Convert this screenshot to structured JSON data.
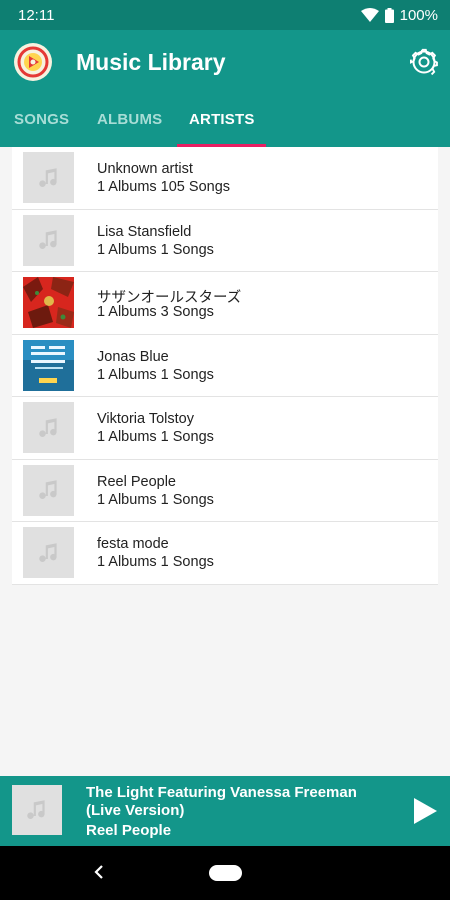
{
  "status": {
    "time": "12:11",
    "battery": "100%"
  },
  "app": {
    "title": "Music Library"
  },
  "tabs": [
    {
      "label": "SONGS",
      "active": false
    },
    {
      "label": "ALBUMS",
      "active": false
    },
    {
      "label": "ARTISTS",
      "active": true
    }
  ],
  "artists": [
    {
      "name": "Unknown artist",
      "stats": "1 Albums 105 Songs",
      "art": "note-icon"
    },
    {
      "name": "Lisa Stansfield",
      "stats": "1 Albums 1 Songs",
      "art": "note-icon"
    },
    {
      "name": "サザンオールスターズ",
      "stats": "1 Albums 3 Songs",
      "art": "red-album-art"
    },
    {
      "name": "Jonas Blue",
      "stats": "1 Albums 1 Songs",
      "art": "blue-album-art"
    },
    {
      "name": "Viktoria Tolstoy",
      "stats": "1 Albums 1 Songs",
      "art": "note-icon"
    },
    {
      "name": "Reel People",
      "stats": "1 Albums 1 Songs",
      "art": "note-icon"
    },
    {
      "name": "festa mode",
      "stats": "1 Albums 1 Songs",
      "art": "note-icon"
    }
  ],
  "player": {
    "title_line1": "The Light Featuring Vanessa Freeman",
    "title_line2": "(Live Version)",
    "artist": "Reel People"
  },
  "colors": {
    "primary": "#13968a",
    "status": "#0e7f72",
    "accent": "#e91e63"
  }
}
